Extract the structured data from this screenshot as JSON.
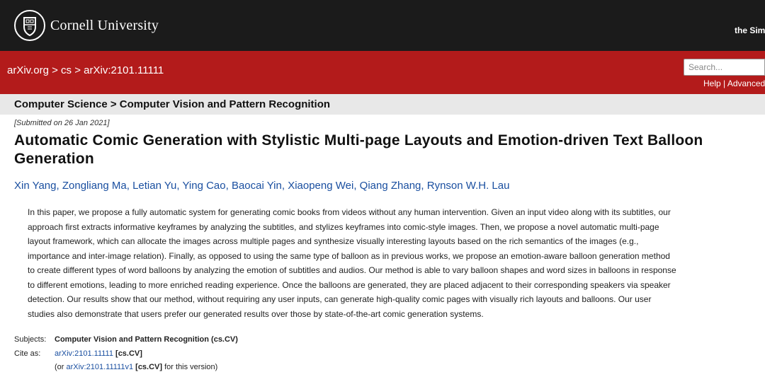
{
  "header": {
    "university_name": "Cornell University",
    "sponsor_text": "the Simo"
  },
  "nav": {
    "crumb_home": "arXiv.org",
    "crumb_sep1": " > ",
    "crumb_cs": "cs",
    "crumb_sep2": " > ",
    "crumb_id": "arXiv:2101.11111"
  },
  "search": {
    "placeholder": "Search...",
    "help_label": "Help",
    "link_sep": " | ",
    "advanced_label": "Advanced"
  },
  "subject_header": "Computer Science > Computer Vision and Pattern Recognition",
  "paper": {
    "submitted": "[Submitted on 26 Jan 2021]",
    "title": "Automatic Comic Generation with Stylistic Multi-page Layouts and Emotion-driven Text Balloon Generation",
    "authors": [
      "Xin Yang",
      "Zongliang Ma",
      "Letian Yu",
      "Ying Cao",
      "Baocai Yin",
      "Xiaopeng Wei",
      "Qiang Zhang",
      "Rynson W.H. Lau"
    ],
    "author_sep": ", ",
    "abstract_lines": [
      "In this paper, we propose a fully automatic system for generating comic books from videos without any human intervention. Given an input video along with its subtitles, our",
      "approach first extracts informative keyframes by analyzing the subtitles, and stylizes keyframes into comic-style images. Then, we propose a novel automatic multi-page",
      "layout framework, which can allocate the images across multiple pages and synthesize visually interesting layouts based on the rich semantics of the images (e.g.,",
      "importance and inter-image relation). Finally, as opposed to using the same type of balloon as in previous works, we propose an emotion-aware balloon generation method",
      "to create different types of word balloons by analyzing the emotion of subtitles and audios. Our method is able to vary balloon shapes and word sizes in balloons in response",
      "to different emotions, leading to more enriched reading experience. Once the balloons are generated, they are placed adjacent to their corresponding speakers via speaker",
      "detection. Our results show that our method, without requiring any user inputs, can generate high-quality comic pages with visually rich layouts and balloons. Our user",
      "studies also demonstrate that users prefer our generated results over those by state-of-the-art comic generation systems."
    ]
  },
  "meta": {
    "subjects_label": "Subjects:",
    "subjects_value": "Computer Vision and Pattern Recognition (cs.CV)",
    "cite_label": "Cite as:",
    "cite_link": "arXiv:2101.11111",
    "cite_tag": " [cs.CV]",
    "version_prefix": "(or ",
    "version_link": "arXiv:2101.11111v1",
    "version_tag": " [cs.CV]",
    "version_suffix": " for this version)"
  },
  "colors": {
    "topbar": "#1b1b1b",
    "arxiv_red": "#b31b1b",
    "link_blue": "#1a4fa0",
    "subject_bar": "#e8e8e8"
  }
}
